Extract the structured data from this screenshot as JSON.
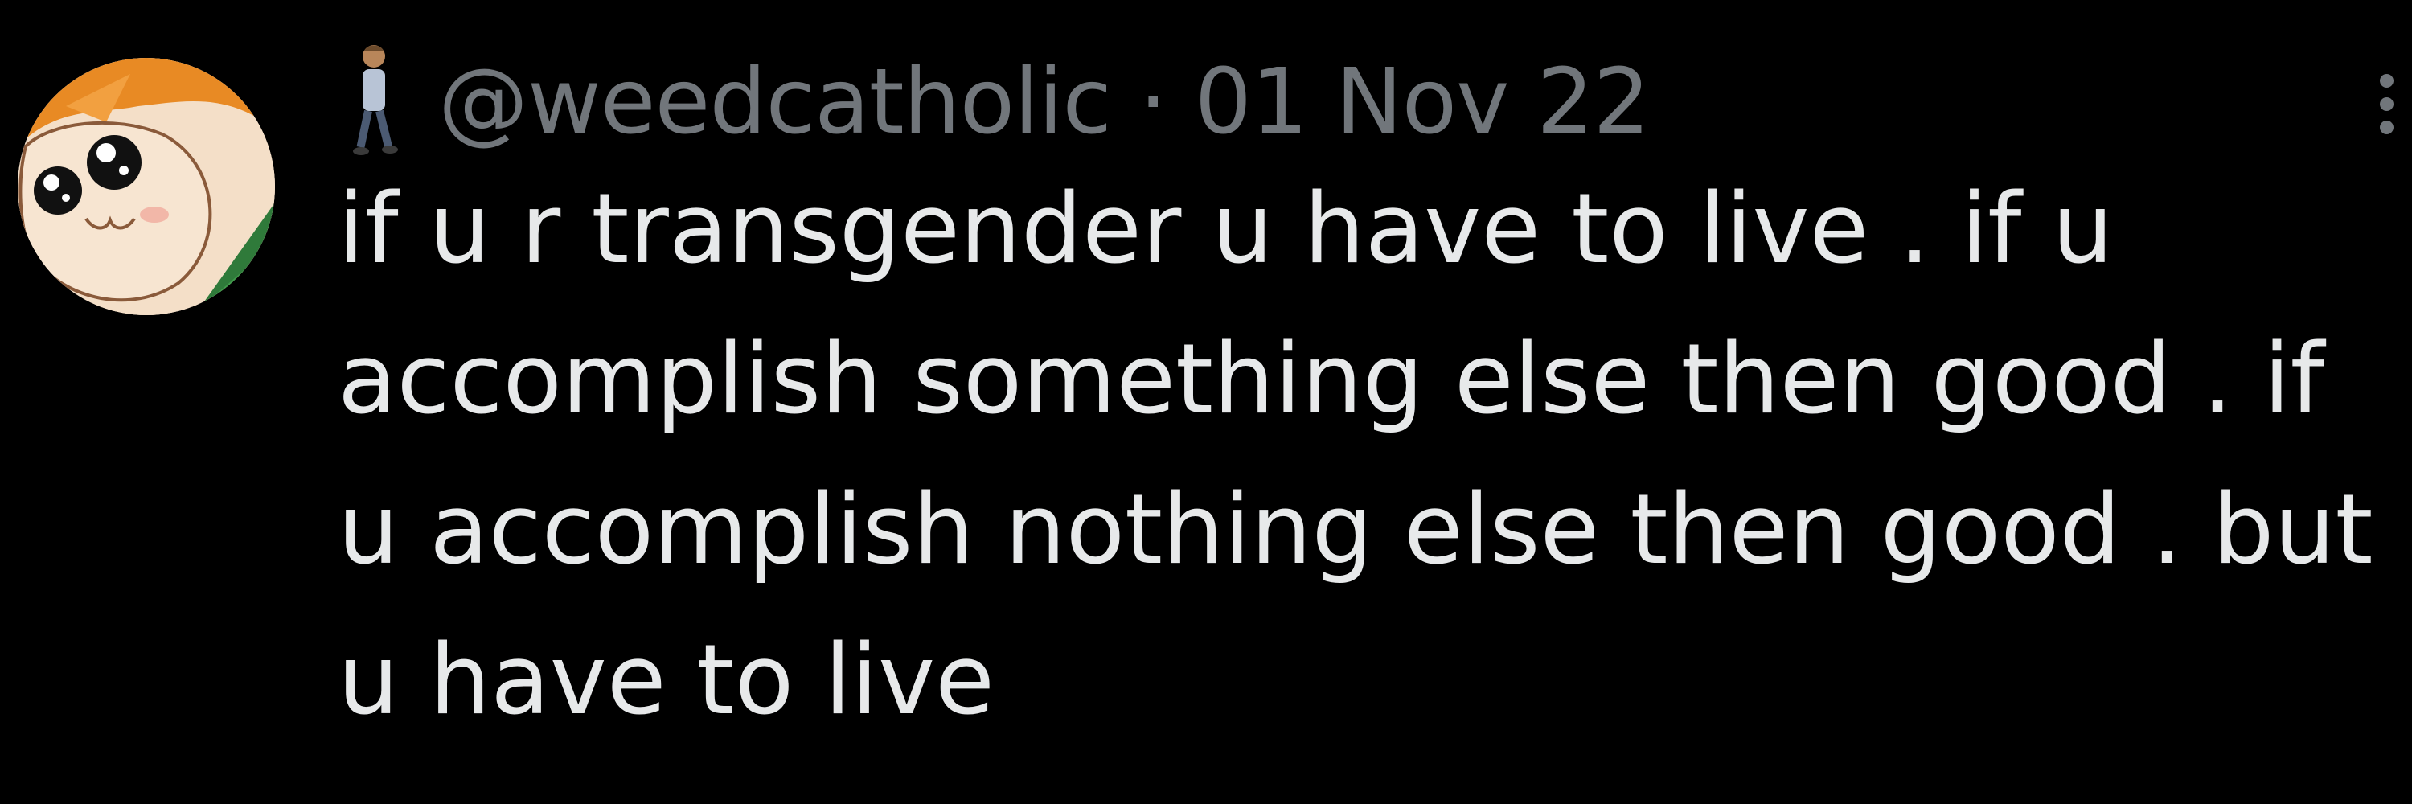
{
  "tweet": {
    "handle": "@weedcatholic",
    "separator": "·",
    "date": "01 Nov 22",
    "meta_line": "@weedcatholic · 01 Nov 22",
    "emoji_icon": "person-walking-icon",
    "more_icon": "more-options-icon",
    "avatar_icon": "cartoon-hamster-avatar",
    "text_lines": [
      "if u r transgender u have to live . if u",
      "accomplish something else then good .  if",
      "u accomplish nothing else then good . but",
      "u have to live"
    ]
  },
  "colors": {
    "background": "#000000",
    "text": "#e7e9ea",
    "secondary_text": "#71767b"
  }
}
